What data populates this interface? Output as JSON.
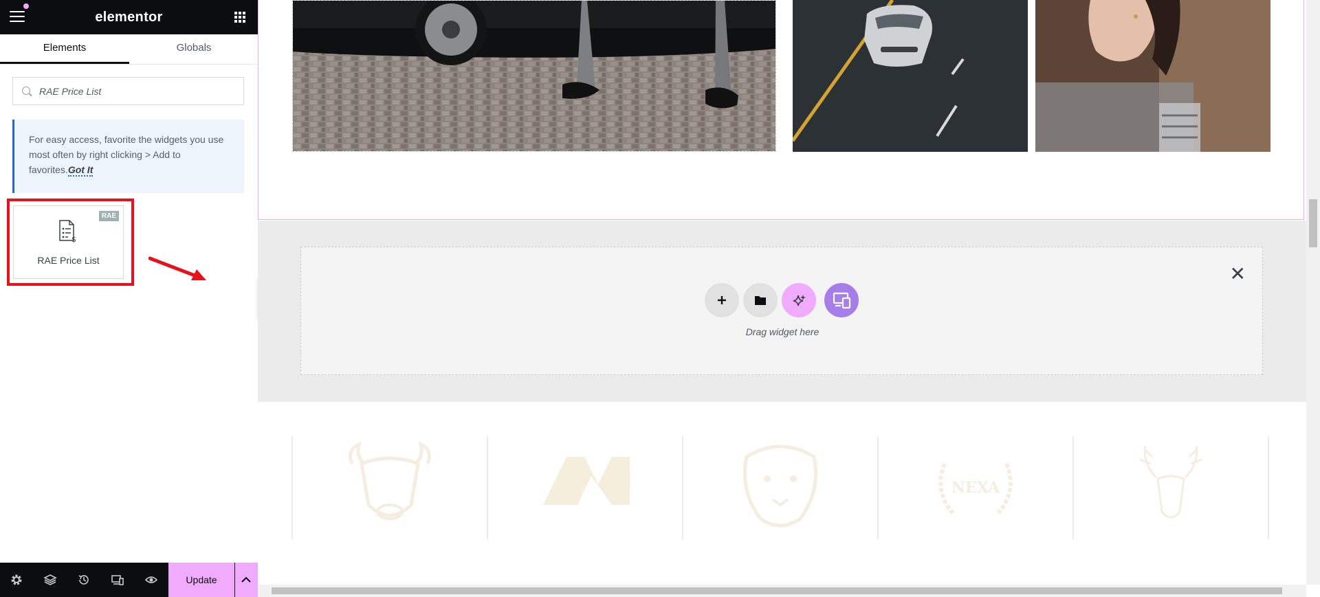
{
  "app": {
    "brand": "elementor"
  },
  "tabs": [
    {
      "label": "Elements"
    },
    {
      "label": "Globals"
    }
  ],
  "search": {
    "value": "RAE Price List",
    "placeholder": "Search Widget..."
  },
  "notice": {
    "text": "For easy access, favorite the widgets you use most often by right clicking > Add to favorites.",
    "link": "Got It"
  },
  "widget": {
    "badge": "RAE",
    "label": "RAE Price List"
  },
  "footer": {
    "update_label": "Update"
  },
  "dropzone": {
    "text": "Drag widget here"
  },
  "logos": [
    "bull-logo",
    "m-logo",
    "lion-logo",
    "nexa-logo",
    "deer-logo"
  ],
  "logo_text": "NEXA",
  "colors": {
    "accent": "#f0abfc",
    "dark": "#0c0d0e",
    "highlight": "#e8111b",
    "notice_border": "#2a66c1"
  }
}
